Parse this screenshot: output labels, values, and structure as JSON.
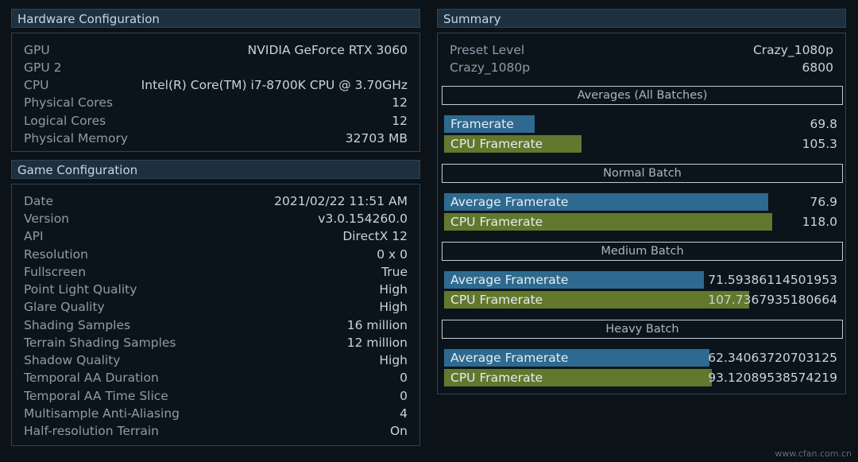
{
  "hardware": {
    "title": "Hardware Configuration",
    "rows": [
      {
        "label": "GPU",
        "value": "NVIDIA GeForce RTX 3060"
      },
      {
        "label": "GPU 2",
        "value": ""
      },
      {
        "label": "CPU",
        "value": "Intel(R) Core(TM) i7-8700K CPU @ 3.70GHz"
      },
      {
        "label": "Physical Cores",
        "value": "12"
      },
      {
        "label": "Logical Cores",
        "value": "12"
      },
      {
        "label": "Physical Memory",
        "value": "32703 MB"
      }
    ]
  },
  "game": {
    "title": "Game Configuration",
    "rows": [
      {
        "label": "Date",
        "value": "2021/02/22 11:51 AM"
      },
      {
        "label": "Version",
        "value": "v3.0.154260.0"
      },
      {
        "label": "API",
        "value": "DirectX 12"
      },
      {
        "label": "Resolution",
        "value": "0 x 0"
      },
      {
        "label": "Fullscreen",
        "value": "True"
      },
      {
        "label": "Point Light Quality",
        "value": "High"
      },
      {
        "label": "Glare Quality",
        "value": "High"
      },
      {
        "label": "Shading Samples",
        "value": "16 million"
      },
      {
        "label": "Terrain Shading Samples",
        "value": "12 million"
      },
      {
        "label": "Shadow Quality",
        "value": "High"
      },
      {
        "label": "Temporal AA Duration",
        "value": "0"
      },
      {
        "label": "Temporal AA Time Slice",
        "value": "0"
      },
      {
        "label": "Multisample Anti-Aliasing",
        "value": "4"
      },
      {
        "label": "Half-resolution Terrain",
        "value": "On"
      }
    ]
  },
  "summary": {
    "title": "Summary",
    "rows": [
      {
        "label": "Preset Level",
        "value": "Crazy_1080p"
      },
      {
        "label": "Crazy_1080p",
        "value": "6800"
      }
    ],
    "sections": [
      {
        "title": "Averages (All Batches)",
        "bars": [
          {
            "label": "Framerate",
            "value": "69.8",
            "fraction": 0.23,
            "color": "#2e6a8f"
          },
          {
            "label": "CPU Framerate",
            "value": "105.3",
            "fraction": 0.35,
            "color": "#62782c"
          }
        ]
      },
      {
        "title": "Normal Batch",
        "bars": [
          {
            "label": "Average Framerate",
            "value": "76.9",
            "fraction": 0.825,
            "color": "#2e6a8f"
          },
          {
            "label": "CPU Framerate",
            "value": "118.0",
            "fraction": 0.835,
            "color": "#62782c"
          }
        ]
      },
      {
        "title": "Medium Batch",
        "bars": [
          {
            "label": "Average Framerate",
            "value": "71.59386114501953",
            "fraction": 0.66,
            "color": "#2e6a8f"
          },
          {
            "label": "CPU Framerate",
            "value": "107.7367935180664",
            "fraction": 0.775,
            "color": "#62782c"
          }
        ]
      },
      {
        "title": "Heavy Batch",
        "bars": [
          {
            "label": "Average Framerate",
            "value": "62.34063720703125",
            "fraction": 0.675,
            "color": "#2e6a8f"
          },
          {
            "label": "CPU Framerate",
            "value": "93.12089538574219",
            "fraction": 0.68,
            "color": "#62782c"
          }
        ]
      }
    ]
  },
  "watermark": "www.cfan.com.cn"
}
